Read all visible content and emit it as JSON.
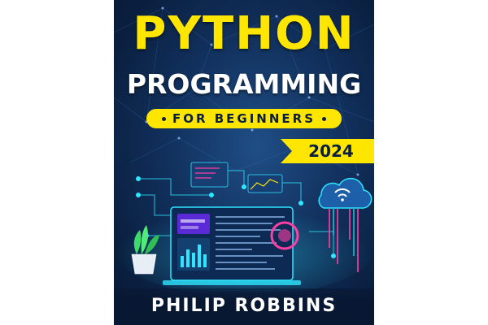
{
  "book": {
    "title_line1": "PYTHON",
    "title_line2": "PROGRAMMING",
    "subtitle": "FOR BEGINNERS",
    "year": "2024",
    "author": "PHILIP ROBBINS"
  },
  "colors": {
    "background_dark": "#0a1f3f",
    "background_mid": "#1f4e86",
    "accent_yellow": "#ffe600",
    "neon_cyan": "#2ee6ff",
    "neon_magenta": "#ff3fa4",
    "text_white": "#ffffff"
  },
  "icons": [
    "plant-pot-icon",
    "cloud-wifi-icon",
    "laptop-dashboard-icon",
    "network-node-icon"
  ]
}
